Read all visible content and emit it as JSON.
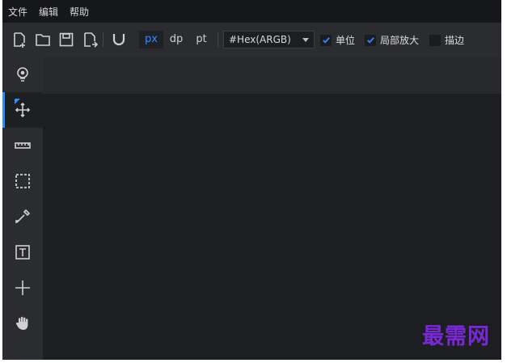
{
  "menu": {
    "file": "文件",
    "edit": "编辑",
    "help": "帮助"
  },
  "toolbar": {
    "icons": [
      "new-file-icon",
      "open-folder-icon",
      "save-icon",
      "export-icon",
      "magnet-icon"
    ],
    "units": [
      "px",
      "dp",
      "pt"
    ],
    "active_unit": "px",
    "color_format": "#Hex(ARGB)",
    "checkboxes": [
      {
        "label": "单位",
        "checked": true
      },
      {
        "label": "局部放大",
        "checked": true
      },
      {
        "label": "描边",
        "checked": false
      }
    ]
  },
  "tools": [
    {
      "icon": "lightbulb-icon",
      "active": false
    },
    {
      "icon": "move-icon",
      "active": true
    },
    {
      "icon": "ruler-icon",
      "active": false
    },
    {
      "icon": "marquee-select-icon",
      "active": false
    },
    {
      "icon": "eyedropper-icon",
      "active": false
    },
    {
      "icon": "text-tool-icon",
      "active": false
    },
    {
      "icon": "crosshair-icon",
      "active": false
    },
    {
      "icon": "hand-icon",
      "active": false
    }
  ],
  "watermark": "最需网",
  "colors": {
    "accent": "#2f8cff",
    "background": "#1e1f22",
    "watermark": "#7a28d6"
  }
}
